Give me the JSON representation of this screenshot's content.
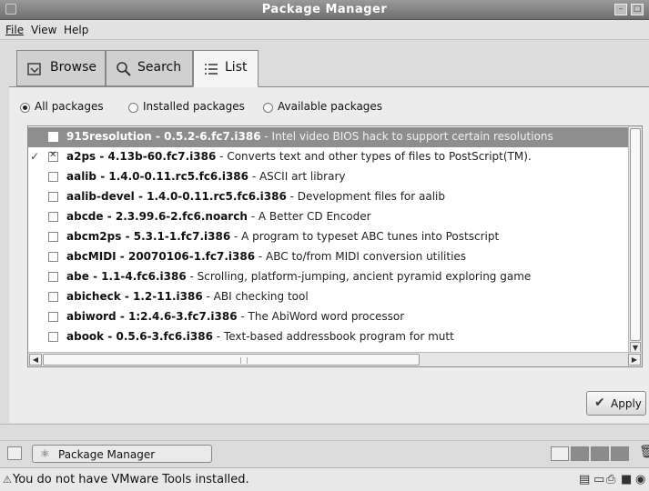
{
  "window": {
    "title": "Package Manager"
  },
  "menu": {
    "file": "File",
    "view": "View",
    "help": "Help"
  },
  "tabs": {
    "browse": "Browse",
    "search": "Search",
    "list": "List",
    "active": "List"
  },
  "filter": {
    "all": "All packages",
    "installed": "Installed packages",
    "available": "Available packages",
    "selected": "All packages"
  },
  "packages": [
    {
      "name": "915resolution - 0.5.2-6.fc7.i386",
      "desc": " - Intel video BIOS hack to support certain resolutions",
      "selected": true,
      "checked": false,
      "installed": false
    },
    {
      "name": "a2ps - 4.13b-60.fc7.i386",
      "desc": " - Converts text and other types of files to PostScript(TM).",
      "selected": false,
      "checked": true,
      "installed": true
    },
    {
      "name": "aalib - 1.4.0-0.11.rc5.fc6.i386",
      "desc": " - ASCII art library",
      "selected": false,
      "checked": false,
      "installed": false
    },
    {
      "name": "aalib-devel - 1.4.0-0.11.rc5.fc6.i386",
      "desc": " - Development files for aalib",
      "selected": false,
      "checked": false,
      "installed": false
    },
    {
      "name": "abcde - 2.3.99.6-2.fc6.noarch",
      "desc": " - A Better CD Encoder",
      "selected": false,
      "checked": false,
      "installed": false
    },
    {
      "name": "abcm2ps - 5.3.1-1.fc7.i386",
      "desc": " - A program to typeset ABC tunes into Postscript",
      "selected": false,
      "checked": false,
      "installed": false
    },
    {
      "name": "abcMIDI - 20070106-1.fc7.i386",
      "desc": " - ABC to/from MIDI conversion utilities",
      "selected": false,
      "checked": false,
      "installed": false
    },
    {
      "name": "abe - 1.1-4.fc6.i386",
      "desc": " - Scrolling, platform-jumping, ancient pyramid exploring game",
      "selected": false,
      "checked": false,
      "installed": false
    },
    {
      "name": "abicheck - 1.2-11.i386",
      "desc": " - ABI checking tool",
      "selected": false,
      "checked": false,
      "installed": false
    },
    {
      "name": "abiword - 1:2.4.6-3.fc7.i386",
      "desc": " - The AbiWord word processor",
      "selected": false,
      "checked": false,
      "installed": false
    },
    {
      "name": "abook - 0.5.6-3.fc6.i386",
      "desc": " - Text-based addressbook program for mutt",
      "selected": false,
      "checked": false,
      "installed": false
    }
  ],
  "apply_label": "Apply",
  "taskbar": {
    "task_label": "Package Manager"
  },
  "status": {
    "message": "You do not have VMware Tools installed."
  },
  "icons": {
    "browse": "browse-icon",
    "search": "search-icon",
    "list": "list-icon",
    "apply": "checkmark-icon",
    "installed": "installed-package-icon"
  }
}
